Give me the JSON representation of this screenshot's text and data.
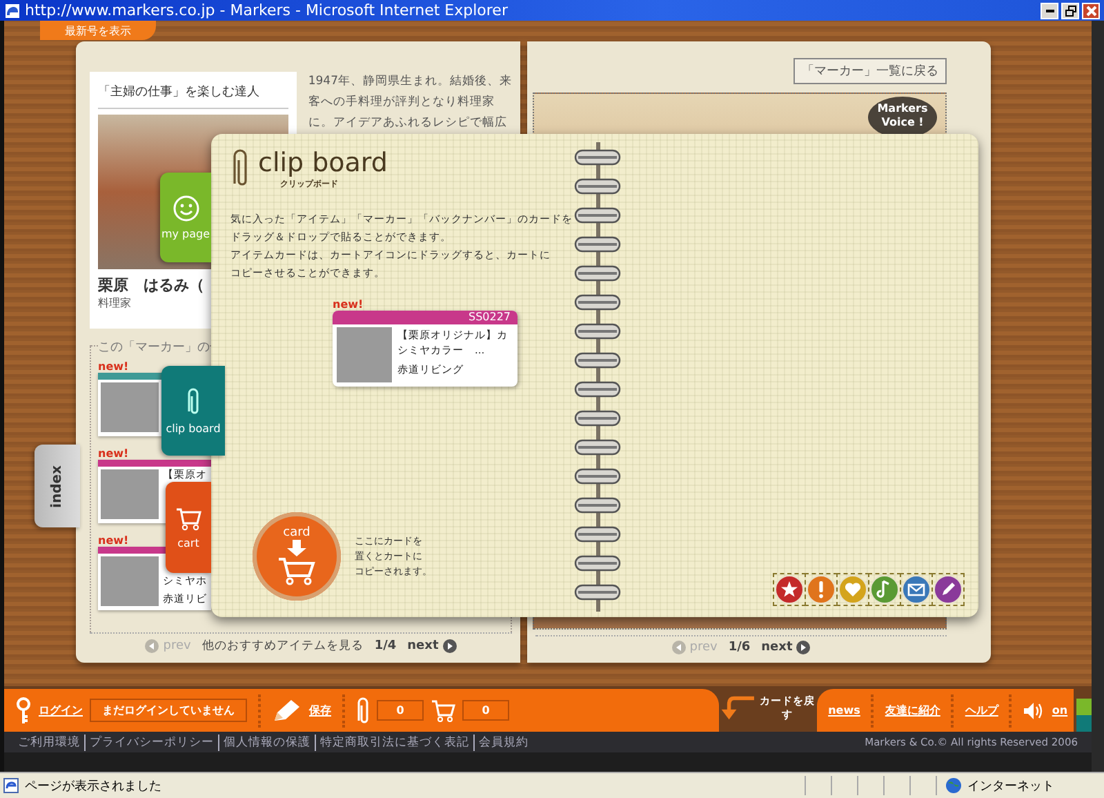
{
  "window": {
    "title": "http://www.markers.co.jp - Markers - Microsoft Internet Explorer"
  },
  "top_tab": {
    "label": "最新号を表示"
  },
  "left_page": {
    "profile": {
      "title": "「主婦の仕事」を楽しむ達人",
      "name": "栗原　はるみ（",
      "role": "料理家"
    },
    "bio": [
      "1947年、静岡県生まれ。結婚後、来",
      "客への手料理が評判となり料理家",
      "に。アイデアあふれるレシピで幅広"
    ],
    "section_title": "この「マーカー」の",
    "items": [
      {
        "badge": "new!",
        "color": "#3f9a96"
      },
      {
        "badge": "new!",
        "color": "#c8388a",
        "lines": [
          "【栗原オ"
        ]
      },
      {
        "badge": "new!",
        "color": "#c8388a",
        "lines": [
          "シミヤホ",
          "赤道リビ"
        ]
      }
    ],
    "pager": {
      "prev": "prev",
      "label": "他のおすすめアイテムを見る",
      "page": "1/4",
      "next": "next"
    }
  },
  "side_tabs": [
    {
      "kind": "smile",
      "label": "my page"
    },
    {
      "kind": "clip",
      "label": "clip board"
    },
    {
      "kind": "cart",
      "label": "cart"
    },
    {
      "kind": "index",
      "label": "index"
    }
  ],
  "right_page": {
    "back_button": "「マーカー」一覧に戻る",
    "voice_badge": [
      "Markers",
      "Voice !"
    ],
    "pager": {
      "prev": "prev",
      "page": "1/6",
      "next": "next"
    }
  },
  "clipboard": {
    "title": "clip board",
    "subtitle": "クリップボード",
    "description": [
      "気に入った「アイテム」「マーカー」「バックナンバー」のカードを",
      "ドラッグ＆ドロップで貼ることができます。",
      "アイテムカードは、カートアイコンにドラッグすると、カートに",
      "コピーさせることができます。"
    ],
    "card": {
      "badge": "new!",
      "code": "SS0227",
      "title": "【栗原オリジナル】カシミヤカラー　...",
      "maker": "赤道リビング"
    },
    "drop": {
      "label": "card",
      "hint": [
        "ここにカードを",
        "置くとカートに",
        "コピーされます。"
      ]
    },
    "stamps": [
      {
        "kind": "star",
        "color": "#c42a2a"
      },
      {
        "kind": "exclamation",
        "color": "#e0741c"
      },
      {
        "kind": "heart",
        "color": "#d4a41c"
      },
      {
        "kind": "note",
        "color": "#5a9a34"
      },
      {
        "kind": "mail",
        "color": "#3a78b8"
      },
      {
        "kind": "pencil",
        "color": "#8a3a9a"
      }
    ]
  },
  "bottom_bar": {
    "login_link": "ログイン",
    "login_status": "まだログインしていません",
    "save_link": "保存",
    "clip_count": "0",
    "cart_count": "0",
    "return_cards": "カードを戻す",
    "links": [
      "news",
      "友達に紹介",
      "ヘルプ"
    ],
    "sound": "on"
  },
  "footer": {
    "links": [
      "ご利用環境",
      "プライバシーポリシー",
      "個人情報の保護",
      "特定商取引法に基づく表記",
      "会員規約"
    ],
    "copyright": "Markers & Co.© All rights Reserved 2006"
  },
  "status_bar": {
    "message": "ページが表示されました",
    "zone": "インターネット"
  }
}
